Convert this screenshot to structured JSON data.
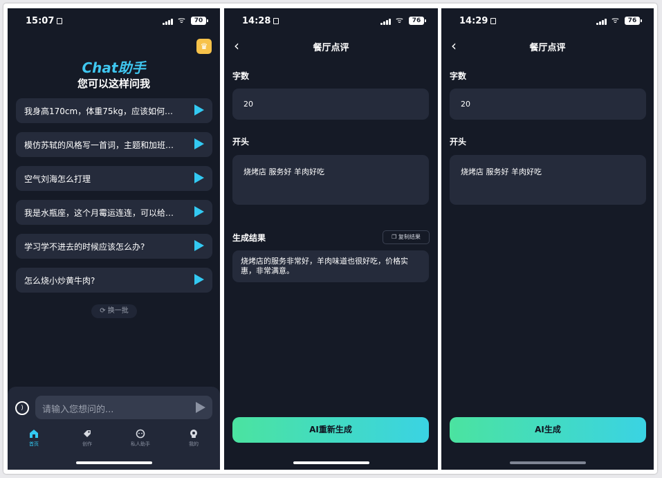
{
  "screen1": {
    "status": {
      "time": "15:07",
      "battery": "70"
    },
    "brand": "Chat助手",
    "subtitle": "您可以这样问我",
    "questions": [
      "我身高170cm，体重75kg，应该如何…",
      "模仿苏轼的风格写一首词，主题和加班…",
      "空气刘海怎么打理",
      "我是水瓶座，这个月霉运连连，可以给…",
      "学习学不进去的时候应该怎么办?",
      "怎么烧小炒黄牛肉?"
    ],
    "refresh_label": "换一批",
    "input_placeholder": "请输入您想问的...",
    "nav": [
      {
        "label": "首页",
        "icon": "home-icon"
      },
      {
        "label": "创作",
        "icon": "tag-icon"
      },
      {
        "label": "私人助手",
        "icon": "assistant-icon"
      },
      {
        "label": "我的",
        "icon": "profile-icon"
      }
    ]
  },
  "screen2": {
    "status": {
      "time": "14:28",
      "battery": "76"
    },
    "title": "餐厅点评",
    "word_count_label": "字数",
    "word_count_value": "20",
    "opening_label": "开头",
    "opening_value": "烧烤店 服务好 羊肉好吃",
    "result_label": "生成结果",
    "copy_label": "复制结果",
    "result_text": "烧烤店的服务非常好，羊肉味道也很好吃，价格实惠，非常满意。",
    "button_label": "AI重新生成"
  },
  "screen3": {
    "status": {
      "time": "14:29",
      "battery": "76"
    },
    "title": "餐厅点评",
    "word_count_label": "字数",
    "word_count_value": "20",
    "opening_label": "开头",
    "opening_value": "烧烤店 服务好 羊肉好吃",
    "button_label": "AI生成"
  },
  "colors": {
    "background": "#151a26",
    "card": "#252b3b",
    "accent": "#33c9f2",
    "gradient_start": "#4be3a0",
    "gradient_end": "#3ad3e3"
  }
}
